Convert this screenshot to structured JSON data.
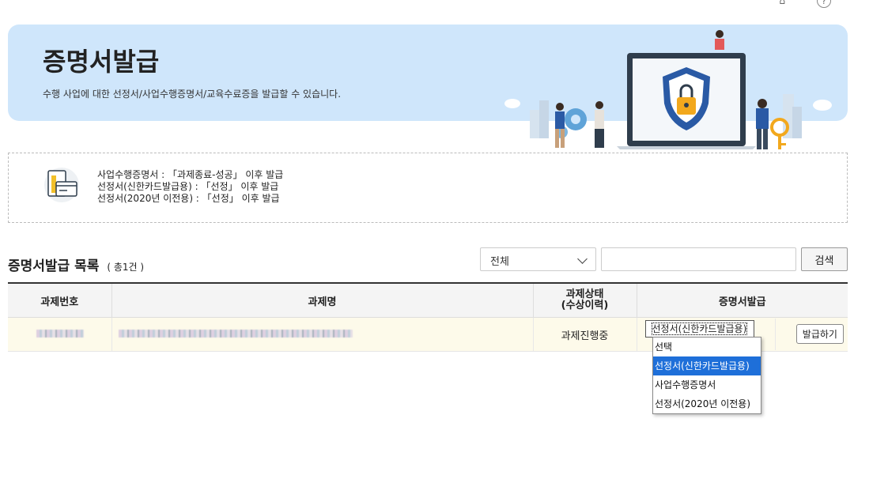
{
  "breadcrumb": {
    "items": [
      "",
      "",
      ""
    ],
    "help": "?"
  },
  "hero": {
    "title": "증명서발급",
    "description": "수행 사업에 대한 선정서/사업수행증명서/교육수료증을 발급할 수 있습니다."
  },
  "notice": {
    "lines": [
      "사업수행증명서 : 「과제종료-성공」 이후 발급",
      "선정서(신한카드발급용) : 「선정」 이후 발급",
      "선정서(2020년 이전용) : 「선정」 이후 발급"
    ]
  },
  "list": {
    "title": "증명서발급 목록",
    "count": "( 총1건 )"
  },
  "search": {
    "filter_value": "전체",
    "input_value": "",
    "button_label": "검색"
  },
  "table": {
    "headers": [
      "과제번호",
      "과제명",
      "과제상태\n(수상이력)",
      "증명서발급"
    ],
    "header_status_line1": "과제상태",
    "header_status_line2": "(수상이력)",
    "rows": [
      {
        "project_no": "",
        "project_name": "",
        "status": "과제진행중",
        "cert_selected": "선정서(신한카드발급용)",
        "issue_label": "발급하기"
      }
    ]
  },
  "dropdown": {
    "options": [
      "선택",
      "선정서(신한카드발급용)",
      "사업수행증명서",
      "선정서(2020년 이전용)"
    ],
    "highlighted_index": 1
  },
  "colors": {
    "hero_bg": "#cfe6fb",
    "row_bg": "#fdfaea",
    "highlight": "#1e6fd9"
  }
}
